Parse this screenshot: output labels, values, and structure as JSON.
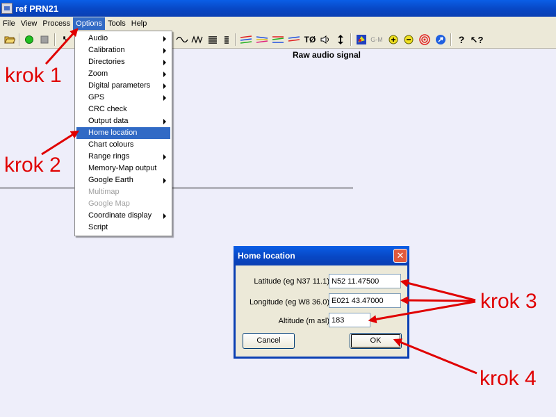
{
  "window": {
    "title": "ref PRN21"
  },
  "menubar": {
    "items": [
      "File",
      "View",
      "Process",
      "Options",
      "Tools",
      "Help"
    ],
    "active": "Options"
  },
  "toolbar": {
    "icons": [
      "open-folder-icon",
      "green-circle-icon",
      "stop-square-icon",
      "gps-icon",
      "wave-icon",
      "squiggle-icon",
      "lines-icon",
      "bar-icon",
      "color-lines-icon",
      "color-lines-2-icon",
      "color-lines-3-icon",
      "color-lines-4-icon",
      "T0-icon",
      "speaker-icon",
      "updown-arrow-icon",
      "map-icon",
      "zoom-in-icon",
      "zoom-out-icon",
      "target-icon",
      "compass-icon",
      "help-icon",
      "context-help-icon"
    ],
    "gm_label": "G-M",
    "t0_label": "TØ"
  },
  "chart": {
    "title": "Raw audio signal"
  },
  "options_menu": {
    "items": [
      {
        "label": "Audio",
        "submenu": true,
        "enabled": true
      },
      {
        "label": "Calibration",
        "submenu": true,
        "enabled": true
      },
      {
        "label": "Directories",
        "submenu": true,
        "enabled": true
      },
      {
        "label": "Zoom",
        "submenu": true,
        "enabled": true
      },
      {
        "label": "Digital parameters",
        "submenu": true,
        "enabled": true
      },
      {
        "label": "GPS",
        "submenu": true,
        "enabled": true
      },
      {
        "label": "CRC check",
        "submenu": false,
        "enabled": true
      },
      {
        "label": "Output data",
        "submenu": true,
        "enabled": true
      },
      {
        "label": "Home location",
        "submenu": false,
        "enabled": true,
        "highlighted": true
      },
      {
        "label": "Chart colours",
        "submenu": false,
        "enabled": true
      },
      {
        "label": "Range rings",
        "submenu": true,
        "enabled": true
      },
      {
        "label": "Memory-Map output",
        "submenu": false,
        "enabled": true
      },
      {
        "label": "Google Earth",
        "submenu": true,
        "enabled": true
      },
      {
        "label": "Multimap",
        "submenu": false,
        "enabled": false
      },
      {
        "label": "Google Map",
        "submenu": false,
        "enabled": false
      },
      {
        "label": "Coordinate display",
        "submenu": true,
        "enabled": true
      },
      {
        "label": "Script",
        "submenu": false,
        "enabled": true
      }
    ]
  },
  "dialog": {
    "title": "Home location",
    "close_label": "✕",
    "latitude_label": "Latitude (eg N37 11.1)",
    "latitude_value": "N52 11.47500",
    "longitude_label": "Longitude (eg W8 36.0)",
    "longitude_value": "E021 43.47000",
    "altitude_label": "Altitude (m asl)",
    "altitude_value": "183",
    "cancel_label": "Cancel",
    "ok_label": "OK"
  },
  "annotations": {
    "krok1": "krok 1",
    "krok2": "krok 2",
    "krok3": "krok 3",
    "krok4": "krok 4",
    "color": "#e00000"
  }
}
